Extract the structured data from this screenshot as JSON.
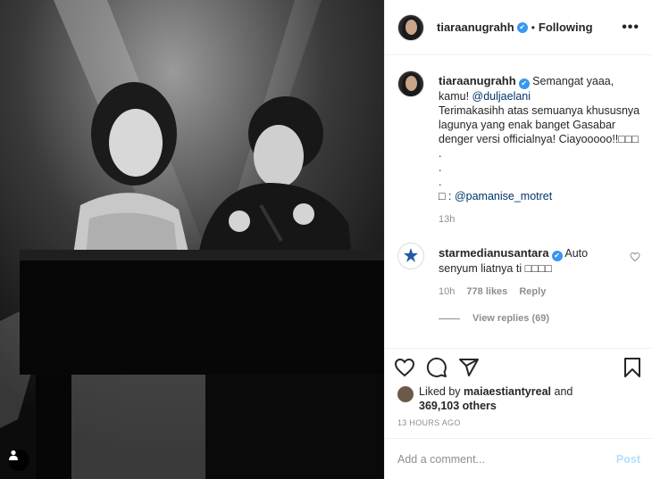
{
  "post": {
    "author": "tiaraanugrahh",
    "follow_label": "Following",
    "more_label": "•••",
    "separator": "•",
    "verified_mark": "✔"
  },
  "caption": {
    "author": "tiaraanugrahh",
    "line1_before": "Semangat yaaa, kamu! ",
    "mention": "@duljaelani",
    "line2": "Terimakasihh atas semuanya khususnya lagunya yang enak banget Gasabar denger versi officialnya! Ciayooooo!!",
    "emoji_row": "□□□",
    "dots": [
      ".",
      ".",
      "."
    ],
    "credit_prefix": "□ : ",
    "credit_mention": "@pamanise_motret",
    "time": "13h"
  },
  "comment": {
    "author": "starmedianusantara",
    "text": "Auto senyum liatnya ti ",
    "emoji": "□□□□",
    "time": "10h",
    "likes": "778 likes",
    "reply_label": "Reply",
    "view_replies": "View replies (69)"
  },
  "likes": {
    "prefix": "Liked by ",
    "user": "maiaestiantyreal",
    "middle": " and",
    "count": "369,103 others"
  },
  "timestamp": "13 HOURS AGO",
  "add_comment": {
    "placeholder": "Add a comment...",
    "post_label": "Post"
  },
  "colors": {
    "link": "#003569",
    "verified": "#3897f0",
    "muted": "#8e8e8e",
    "post_disabled": "#b2dffc"
  },
  "icons": [
    "heart-icon",
    "comment-icon",
    "share-icon",
    "bookmark-icon",
    "user-tag-icon",
    "more-icon"
  ]
}
